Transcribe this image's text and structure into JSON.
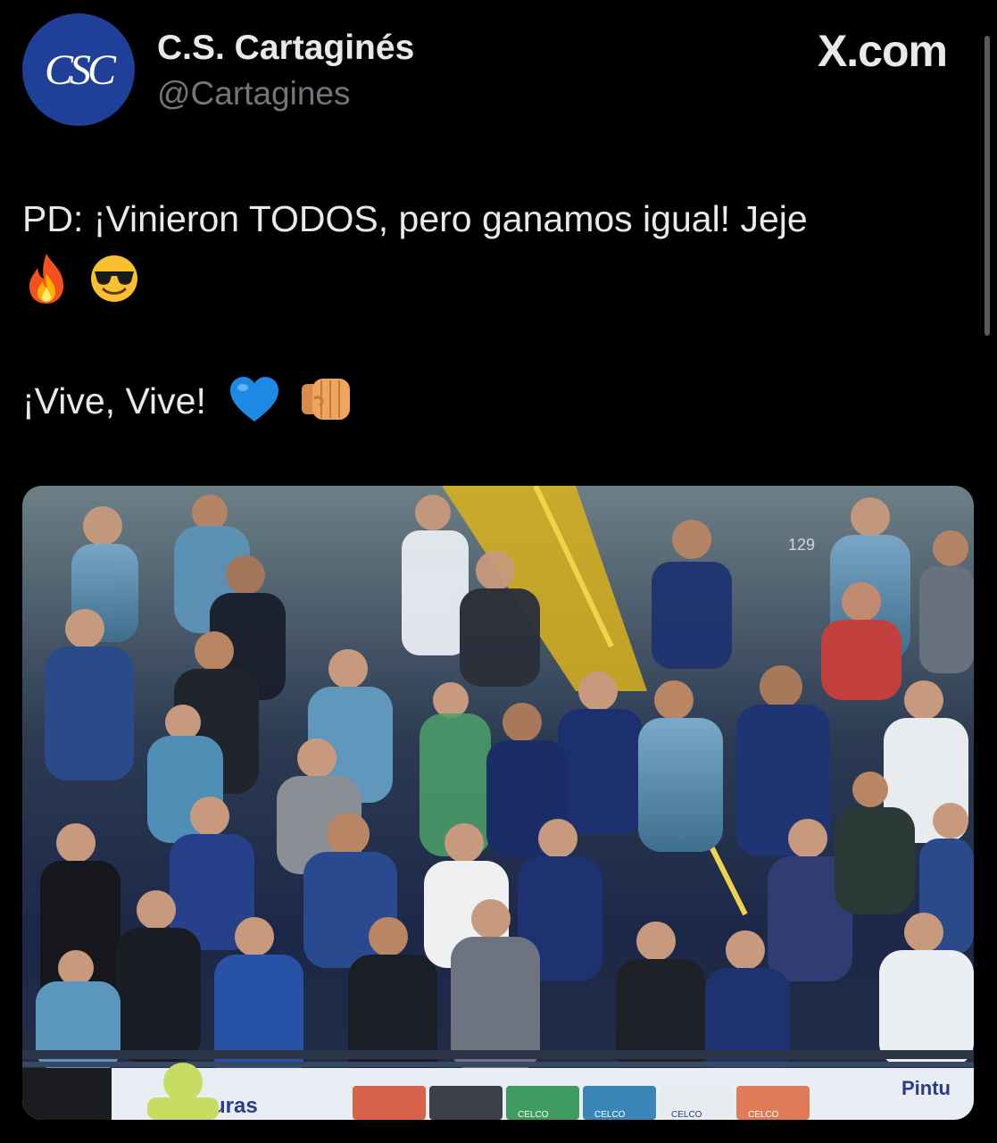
{
  "account": {
    "avatar_text": "CSC",
    "display_name": "C.S. Cartaginés",
    "handle": "@Cartagines"
  },
  "brand": "X.com",
  "tweet": {
    "line1": "PD: ¡Vinieron TODOS, pero ganamos igual! Jeje",
    "line2_emojis": [
      "fire-icon",
      "sunglasses-face-icon"
    ],
    "line3": "¡Vive, Vive!",
    "line3_emojis": [
      "blue-heart-icon",
      "fist-bump-icon"
    ]
  },
  "media": {
    "seat_number": "129",
    "banner_left": "turas",
    "banner_right": "Pintu",
    "sponsor_cans": [
      "CELCO",
      "CELCO",
      "CELCO",
      "CELCO",
      "CELCO"
    ]
  },
  "colors": {
    "background": "#000000",
    "avatar": "#1f3f99",
    "text": "#e7e9ea",
    "muted": "#71767b"
  }
}
